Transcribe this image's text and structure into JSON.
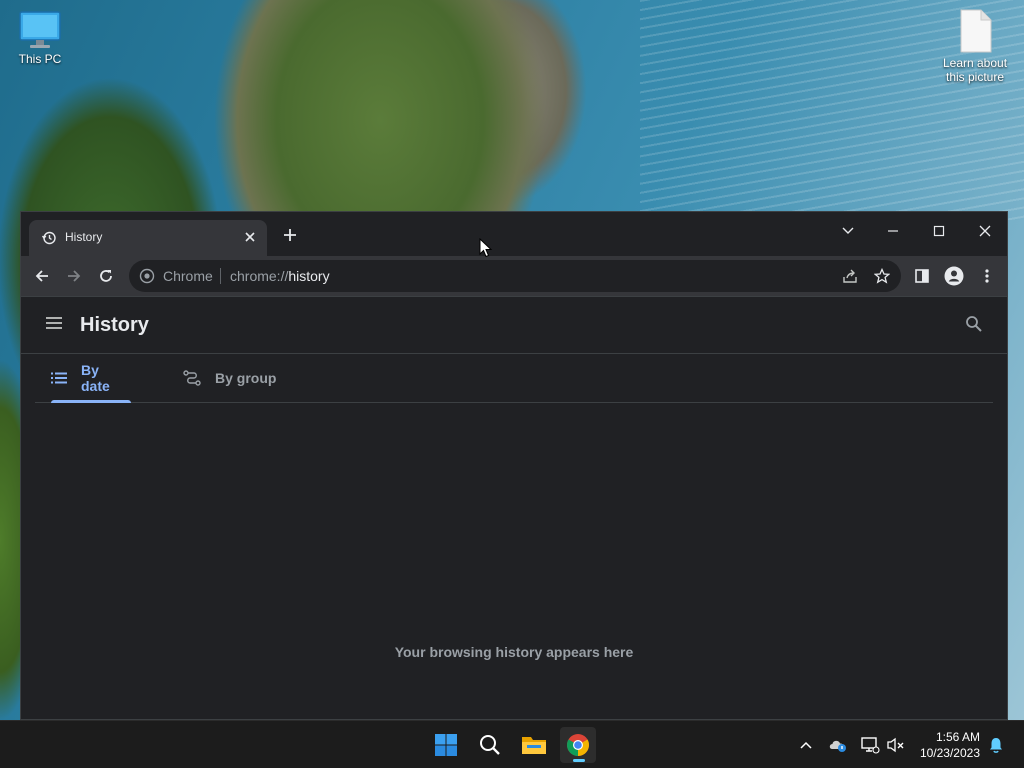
{
  "desktop": {
    "icons": [
      {
        "label": "This PC",
        "icon": "monitor-icon"
      },
      {
        "label": "Learn about this picture",
        "icon": "document-icon"
      }
    ]
  },
  "browser": {
    "tab": {
      "title": "History",
      "icon": "history-icon"
    },
    "toolbar": {
      "site_label": "Chrome",
      "url_scheme": "chrome://",
      "url_host": "history"
    },
    "page": {
      "title": "History",
      "tabs": [
        {
          "label": "By date",
          "active": true
        },
        {
          "label": "By group",
          "active": false
        }
      ],
      "empty_message": "Your browsing history appears here"
    }
  },
  "taskbar": {
    "pinned": [
      "windows-start-icon",
      "search-icon",
      "file-explorer-icon",
      "chrome-icon"
    ],
    "clock": {
      "time": "1:56 AM",
      "date": "10/23/2023"
    }
  },
  "colors": {
    "accent": "#8ab4f8",
    "page_bg": "#202124",
    "toolbar_bg": "#35363a",
    "taskbar_bg": "#1c1c1c"
  }
}
